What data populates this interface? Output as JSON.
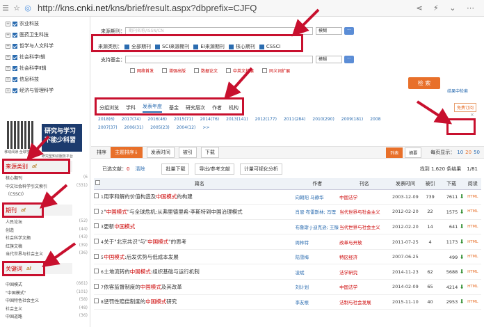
{
  "browser": {
    "url_prefix": "http://kns.",
    "url_host": "cnki.net",
    "url_path": "/kns/brief/result.aspx?dbprefix=CJFQ"
  },
  "sidebar": {
    "categories": [
      "农业科技",
      "医药卫生科技",
      "哲学与人文科学",
      "社会科学Ⅰ辑",
      "社会科学Ⅱ辑",
      "信息科技",
      "经济与管理科学"
    ],
    "banner_text": [
      "研究与学习",
      "不能少科習"
    ],
    "qr_caption": "移动阅读·全球学术快报",
    "banner_caption": "研究型知识服务平台",
    "sections": [
      {
        "title": "来源类别",
        "logo": "ali",
        "items": [
          {
            "label": "核心期刊",
            "count": "(6"
          },
          {
            "label": "中文社会科学引文索引",
            "count": "(331)"
          },
          {
            "label": "（CSSCI）",
            "count": ""
          }
        ]
      },
      {
        "title": "期刊",
        "logo": "ali",
        "items": [
          {
            "label": "人民论坛",
            "count": "(52)"
          },
          {
            "label": "创造",
            "count": "(44)"
          },
          {
            "label": "社会科学文摘",
            "count": "(43)"
          },
          {
            "label": "红旗文稿",
            "count": "(39)"
          },
          {
            "label": "当代世界与社会主义",
            "count": "(36)"
          }
        ]
      },
      {
        "title": "关键词",
        "logo": "ali",
        "items": [
          {
            "label": "中国模式",
            "count": "(661)"
          },
          {
            "label": "\"中国模式\"",
            "count": "(101)"
          },
          {
            "label": "中国特色社会主义",
            "count": "(58)"
          },
          {
            "label": "社会主义",
            "count": "(48)"
          },
          {
            "label": "中国道路",
            "count": "(36)"
          }
        ]
      }
    ]
  },
  "search": {
    "source_label": "来源期刊：",
    "source_placeholder": "期刊名称/ISSN/CN",
    "match_label": "模糊",
    "category_label": "来源类别：",
    "categories": [
      "全部期刊",
      "SCI来源期刊",
      "EI来源期刊",
      "核心期刊",
      "CSSCI"
    ],
    "fund_label": "支持基金：",
    "options": [
      "网络首发",
      "增强出版",
      "数据论文",
      "中英文扩展",
      "同义词扩展"
    ],
    "search_button": "检 索",
    "result_search": "结果中检索"
  },
  "grouping": {
    "tabs": [
      "分组浏览",
      "学科",
      "发表年度",
      "基金",
      "研究层次",
      "作者",
      "机构"
    ],
    "active": "发表年度",
    "free_sub": "免费订阅"
  },
  "years": [
    "2018(6)",
    "2017(74)",
    "2016(46)",
    "2015(71)",
    "2014(76)",
    "2013(141)",
    "2012(177)",
    "2011(284)",
    "2010(290)",
    "2009(181)",
    "2008",
    "2007(37)",
    "2006(31)",
    "2005(23)",
    "2004(12)",
    ">>"
  ],
  "toolbar": {
    "sort": "排序",
    "relevance": "主题排序↓",
    "date": "发表时间",
    "cited": "被引",
    "downloads": "下载",
    "list": "列表",
    "abstract": "摘要",
    "per_page": "每页显示：",
    "sizes": [
      "10",
      "20",
      "50"
    ]
  },
  "selection": {
    "selected": "已选文献：",
    "count": "0",
    "clear": "清除",
    "batch": "批量下载",
    "export": "导出/参考文献",
    "viz": "计量可视化分析",
    "found": "找到 1,620 条结果",
    "pages": "1/81"
  },
  "table": {
    "headers": [
      "篇名",
      "作者",
      "刊名",
      "发表时间",
      "被引",
      "下载",
      "阅读"
    ],
    "rows": [
      {
        "idx": "1",
        "pre": "用李和解的价值构造及",
        "kw": "中国模式",
        "post": "的构建",
        "author": "向朝阳 马静华",
        "source": "中国法学",
        "date": "2003-12-09",
        "cited": "739",
        "dl": "7611",
        "read": "HTML"
      },
      {
        "idx": "2",
        "pre": "\"",
        "kw": "中国模式",
        "post": "\"与全球危机:从弗里德里希·李斯特到中国治理模式",
        "author": "肖恩·布雷斯林; 冯理",
        "source": "当代世界与社会主义",
        "date": "2012-02-20",
        "cited": "22",
        "dl": "1575",
        "read": "HTML"
      },
      {
        "idx": "3",
        "pre": "更新",
        "kw": "中国模式",
        "post": "",
        "author": "布鲁斯·J·迪克逊; 王臻",
        "source": "当代世界与社会主义",
        "date": "2012-02-20",
        "cited": "14",
        "dl": "641",
        "read": "HTML"
      },
      {
        "idx": "4",
        "pre": "关于\"北京共识\"与\"",
        "kw": "中国模式",
        "post": "\"的思考",
        "author": "周林特",
        "source": "改革与开放",
        "date": "2011-07-25",
        "cited": "4",
        "dl": "1173",
        "read": "HTML"
      },
      {
        "idx": "5",
        "pre": "",
        "kw": "中国模式",
        "post": ":后发优势与低成本发展",
        "author": "陆雪梅",
        "source": "特区经济",
        "date": "2007-06-25",
        "cited": "",
        "dl": "499",
        "read": "HTML"
      },
      {
        "idx": "6",
        "pre": "土地流转的",
        "kw": "中国模式",
        "post": ":组织基础与运行机制",
        "author": "凌斌",
        "source": "法学研究",
        "date": "2014-11-23",
        "cited": "62",
        "dl": "5688",
        "read": "HTML"
      },
      {
        "idx": "7",
        "pre": "依客监督制度的",
        "kw": "中国模式",
        "post": "及其改革",
        "author": "刘计划",
        "source": "中国法学",
        "date": "2014-02-09",
        "cited": "65",
        "dl": "4214",
        "read": "HTML"
      },
      {
        "idx": "8",
        "pre": "惩罚性赔偿制度的",
        "kw": "中国模式",
        "post": "研究",
        "author": "李友根",
        "source": "法制与社会发展",
        "date": "2015-11-10",
        "cited": "40",
        "dl": "2953",
        "read": "HTML"
      }
    ]
  }
}
